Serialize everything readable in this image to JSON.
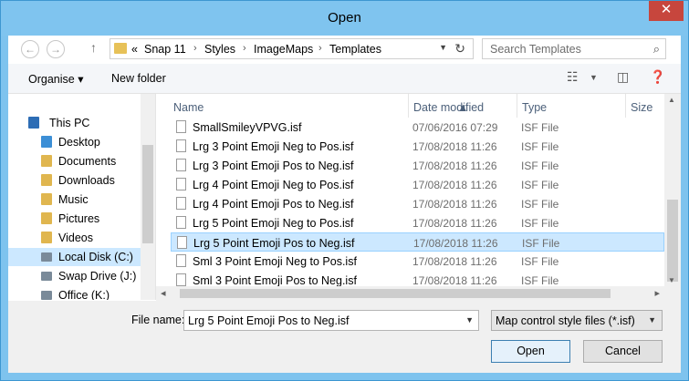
{
  "window": {
    "title": "Open",
    "close_glyph": "✕"
  },
  "address_bar": {
    "overflow": "«",
    "breadcrumbs": [
      "Snap 11",
      "Styles",
      "ImageMaps",
      "Templates"
    ],
    "separator": "›"
  },
  "search": {
    "placeholder": "Search Templates"
  },
  "toolbar": {
    "organise_label": "Organise ▾",
    "new_folder_label": "New folder"
  },
  "nav_pane": {
    "items": [
      {
        "label": "This PC",
        "icon": "computer-icon",
        "color": "#2d6db5"
      },
      {
        "label": "Desktop",
        "icon": "desktop-folder-icon",
        "color": "#3c8fd6"
      },
      {
        "label": "Documents",
        "icon": "documents-folder-icon",
        "color": "#e0b64f"
      },
      {
        "label": "Downloads",
        "icon": "downloads-folder-icon",
        "color": "#e0b64f"
      },
      {
        "label": "Music",
        "icon": "music-folder-icon",
        "color": "#e0b64f"
      },
      {
        "label": "Pictures",
        "icon": "pictures-folder-icon",
        "color": "#e0b64f"
      },
      {
        "label": "Videos",
        "icon": "videos-folder-icon",
        "color": "#e0b64f"
      },
      {
        "label": "Local Disk (C:)",
        "icon": "local-disk-icon",
        "color": "#7a8a99"
      },
      {
        "label": "Swap Drive (J:)",
        "icon": "network-drive-icon",
        "color": "#7a8a99"
      },
      {
        "label": "Office (K:)",
        "icon": "network-drive-icon",
        "color": "#7a8a99"
      }
    ],
    "selected_index": 7
  },
  "file_list": {
    "columns": [
      "Name",
      "Date modified",
      "Type",
      "Size"
    ],
    "rows": [
      {
        "name": "SmallSmileyVPVG.isf",
        "date": "07/06/2016 07:29",
        "type": "ISF File"
      },
      {
        "name": "Lrg 3 Point Emoji Neg to Pos.isf",
        "date": "17/08/2018 11:26",
        "type": "ISF File"
      },
      {
        "name": "Lrg 3 Point Emoji Pos to Neg.isf",
        "date": "17/08/2018 11:26",
        "type": "ISF File"
      },
      {
        "name": "Lrg 4 Point Emoji Neg to Pos.isf",
        "date": "17/08/2018 11:26",
        "type": "ISF File"
      },
      {
        "name": "Lrg 4 Point Emoji Pos to Neg.isf",
        "date": "17/08/2018 11:26",
        "type": "ISF File"
      },
      {
        "name": "Lrg 5 Point Emoji Neg to Pos.isf",
        "date": "17/08/2018 11:26",
        "type": "ISF File"
      },
      {
        "name": "Lrg 5 Point Emoji Pos to Neg.isf",
        "date": "17/08/2018 11:26",
        "type": "ISF File"
      },
      {
        "name": "Sml 3 Point Emoji Neg to Pos.isf",
        "date": "17/08/2018 11:26",
        "type": "ISF File"
      },
      {
        "name": "Sml 3 Point Emoji Pos to Neg.isf",
        "date": "17/08/2018 11:26",
        "type": "ISF File"
      }
    ],
    "selected_index": 6
  },
  "bottom": {
    "file_name_label": "File name:",
    "file_name_value": "Lrg 5 Point Emoji Pos to Neg.isf",
    "filter_value": "Map control style files (*.isf)",
    "open_label": "Open",
    "cancel_label": "Cancel"
  },
  "colors": {
    "title_bar": "#7fc4ef",
    "selection": "#cce8ff",
    "close_button": "#c7463d"
  }
}
